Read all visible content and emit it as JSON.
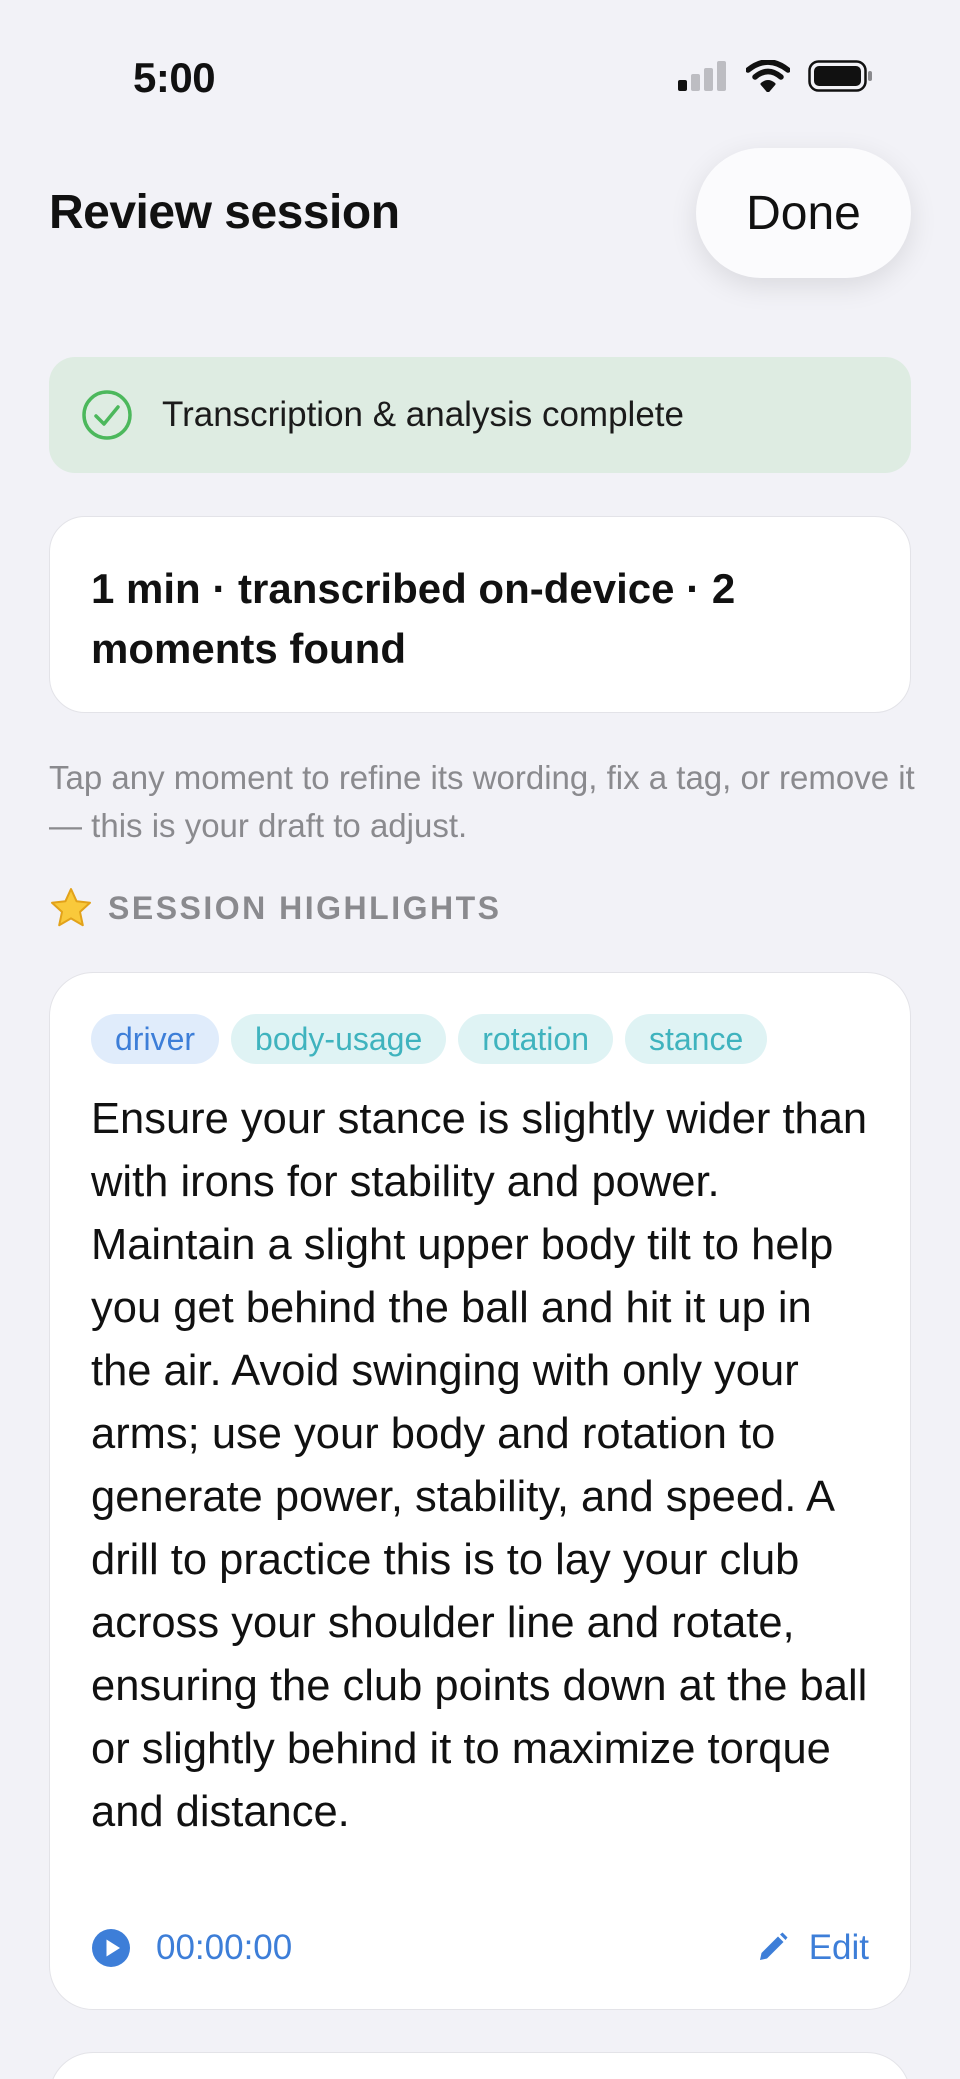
{
  "status_bar": {
    "time": "5:00",
    "icons": [
      "cellular-signal-icon",
      "wifi-icon",
      "battery-icon"
    ]
  },
  "header": {
    "title": "Review session",
    "done_label": "Done"
  },
  "banner": {
    "icon": "check-circle-icon",
    "text": "Transcription & analysis complete"
  },
  "summary": {
    "text": "1 min · transcribed on-device · 2 moments found"
  },
  "hint": "Tap any moment to refine its wording, fix a tag, or remove it — this is your draft to adjust.",
  "section": {
    "icon": "star-icon",
    "title": "SESSION HIGHLIGHTS"
  },
  "highlights": [
    {
      "tags": [
        "driver",
        "body-usage",
        "rotation",
        "stance"
      ],
      "text": "Ensure your stance is slightly wider than with irons for stability and power. Maintain a slight upper body tilt to help you get behind the ball and hit it up in the air. Avoid swinging with only your arms; use your body and rotation to generate power, stability, and speed. A drill to practice this is to lay your club across your shoulder line and rotate, ensuring the club points down at the ball or slightly behind it to maximize torque and distance.",
      "timestamp": "00:00:00",
      "edit_label": "Edit"
    }
  ],
  "colors": {
    "background": "#f2f2f7",
    "accent": "#3d7ed8",
    "success": "#4cb85c",
    "banner_bg": "#deece2",
    "tag_blue_bg": "#e0ecfb",
    "tag_teal_bg": "#dff3f4",
    "tag_teal_text": "#3fb3be",
    "muted_text": "#8a8a8e"
  }
}
